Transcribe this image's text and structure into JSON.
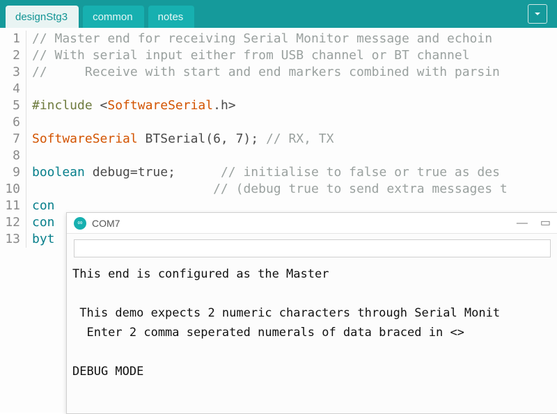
{
  "tabs": [
    {
      "label": "designStg3",
      "active": true
    },
    {
      "label": "common",
      "active": false
    },
    {
      "label": "notes",
      "active": false
    }
  ],
  "code": {
    "lines": [
      {
        "n": 1,
        "tokens": [
          {
            "c": "tok-comment",
            "t": "// Master end for receiving Serial Monitor message and echoin"
          }
        ]
      },
      {
        "n": 2,
        "tokens": [
          {
            "c": "tok-comment",
            "t": "// With serial input either from USB channel or BT channel"
          }
        ]
      },
      {
        "n": 3,
        "tokens": [
          {
            "c": "tok-comment",
            "t": "//     Receive with start and end markers combined with parsin"
          }
        ]
      },
      {
        "n": 4,
        "tokens": []
      },
      {
        "n": 5,
        "tokens": [
          {
            "c": "tok-preproc",
            "t": "#include "
          },
          {
            "c": "tok-angle",
            "t": "<"
          },
          {
            "c": "tok-type",
            "t": "SoftwareSerial"
          },
          {
            "c": "tok-angle",
            "t": ".h>"
          }
        ]
      },
      {
        "n": 6,
        "tokens": []
      },
      {
        "n": 7,
        "tokens": [
          {
            "c": "tok-type",
            "t": "SoftwareSerial"
          },
          {
            "c": "tok-plain",
            "t": " BTSerial(6, 7); "
          },
          {
            "c": "tok-comment",
            "t": "// RX, TX"
          }
        ]
      },
      {
        "n": 8,
        "tokens": []
      },
      {
        "n": 9,
        "tokens": [
          {
            "c": "tok-keyword",
            "t": "boolean"
          },
          {
            "c": "tok-plain",
            "t": " debug=true;      "
          },
          {
            "c": "tok-comment",
            "t": "// initialise to false or true as des"
          }
        ]
      },
      {
        "n": 10,
        "tokens": [
          {
            "c": "tok-plain",
            "t": "                        "
          },
          {
            "c": "tok-comment",
            "t": "// (debug true to send extra messages t"
          }
        ]
      },
      {
        "n": 11,
        "tokens": [
          {
            "c": "tok-keyword",
            "t": "con"
          }
        ]
      },
      {
        "n": 12,
        "tokens": [
          {
            "c": "tok-keyword",
            "t": "con"
          }
        ]
      },
      {
        "n": 13,
        "tokens": [
          {
            "c": "tok-keyword",
            "t": "byt"
          }
        ]
      }
    ]
  },
  "serial_monitor": {
    "title": "COM7",
    "input_value": "",
    "controls": {
      "minimize": "—",
      "maximize": "▭"
    },
    "output_lines": [
      "This end is configured as the Master",
      "",
      " This demo expects 2 numeric characters through Serial Monit",
      "  Enter 2 comma seperated numerals of data braced in <>",
      "",
      "DEBUG MODE"
    ]
  }
}
